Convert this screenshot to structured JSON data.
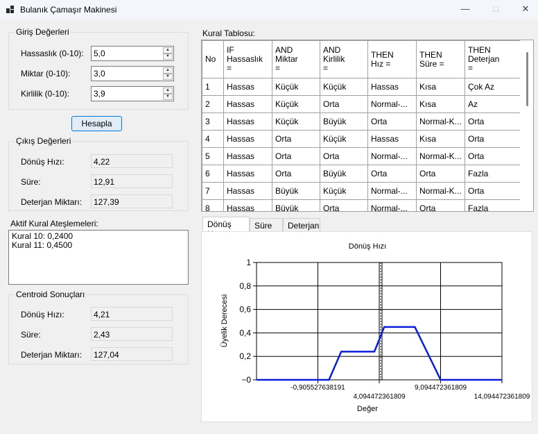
{
  "window": {
    "title": "Bulanık Çamaşır Makinesi"
  },
  "inputs": {
    "title": "Giriş Değerleri",
    "fields": [
      {
        "label": "Hassaslık (0-10):",
        "value": "5,0"
      },
      {
        "label": "Miktar (0-10):",
        "value": "3,0"
      },
      {
        "label": "Kirlilik (0-10):",
        "value": "3,9"
      }
    ]
  },
  "calc_button": "Hesapla",
  "outputs": {
    "title": "Çıkış Değerleri",
    "fields": [
      {
        "label": "Dönüş Hızı:",
        "value": "4,22"
      },
      {
        "label": "Süre:",
        "value": "12,91"
      },
      {
        "label": "Deterjan Miktarı:",
        "value": "127,39"
      }
    ]
  },
  "active_rules": {
    "title": "Aktif Kural Ateşlemeleri:",
    "items": [
      "Kural 10: 0,2400",
      "Kural 11: 0,4500"
    ]
  },
  "centroid": {
    "title": "Centroid Sonuçları",
    "fields": [
      {
        "label": "Dönüş Hızı:",
        "value": "4,21"
      },
      {
        "label": "Süre:",
        "value": "2,43"
      },
      {
        "label": "Deterjan Miktarı:",
        "value": "127,04"
      }
    ]
  },
  "rule_table": {
    "title": "Kural Tablosu:",
    "headers": [
      [
        "No"
      ],
      [
        "IF",
        "Hassaslık",
        "="
      ],
      [
        "AND",
        "Miktar",
        "="
      ],
      [
        "AND",
        "Kirlilik",
        "="
      ],
      [
        "THEN",
        "Hız ="
      ],
      [
        "THEN",
        "Süre ="
      ],
      [
        "THEN",
        "Deterjan",
        "="
      ]
    ],
    "rows": [
      [
        "1",
        "Hassas",
        "Küçük",
        "Küçük",
        "Hassas",
        "Kısa",
        "Çok Az"
      ],
      [
        "2",
        "Hassas",
        "Küçük",
        "Orta",
        "Normal-...",
        "Kısa",
        "Az"
      ],
      [
        "3",
        "Hassas",
        "Küçük",
        "Büyük",
        "Orta",
        "Normal-K...",
        "Orta"
      ],
      [
        "4",
        "Hassas",
        "Orta",
        "Küçük",
        "Hassas",
        "Kısa",
        "Orta"
      ],
      [
        "5",
        "Hassas",
        "Orta",
        "Orta",
        "Normal-...",
        "Normal-K...",
        "Orta"
      ],
      [
        "6",
        "Hassas",
        "Orta",
        "Büyük",
        "Orta",
        "Orta",
        "Fazla"
      ],
      [
        "7",
        "Hassas",
        "Büyük",
        "Küçük",
        "Normal-...",
        "Normal-K...",
        "Orta"
      ],
      [
        "8",
        "Hassas",
        "Büyük",
        "Orta",
        "Normal-...",
        "Orta",
        "Fazla"
      ]
    ]
  },
  "tabs": [
    "Dönüş Hızı",
    "Süre",
    "Deterjan"
  ],
  "chart_data": {
    "type": "line",
    "title": "Dönüş Hızı",
    "xlabel": "Değer",
    "ylabel": "Üyelik Derecesi",
    "xlim": [
      -5.905527638191,
      14.094472361809
    ],
    "ylim": [
      0,
      1
    ],
    "yticks": [
      "−0",
      "0,2",
      "0,4",
      "0,6",
      "0,8",
      "1"
    ],
    "xticks": [
      {
        "value": -0.905527638191,
        "label": "-0,905527638191"
      },
      {
        "value": 4.094472361809,
        "label": "4,094472361809"
      },
      {
        "value": 9.094472361809,
        "label": "9,094472361809"
      },
      {
        "value": 14.094472361809,
        "label": "14,094472361809"
      }
    ],
    "centroid_line": 4.21,
    "series": [
      {
        "color": "#0a1fd6",
        "x": [
          -5.9,
          -0.9,
          0.0,
          1.0,
          3.2,
          3.7,
          4.5,
          6.5,
          7.0,
          9.1,
          14.1
        ],
        "y": [
          0,
          0,
          0,
          0.24,
          0.24,
          0.24,
          0.45,
          0.45,
          0.45,
          0,
          0
        ]
      }
    ]
  }
}
